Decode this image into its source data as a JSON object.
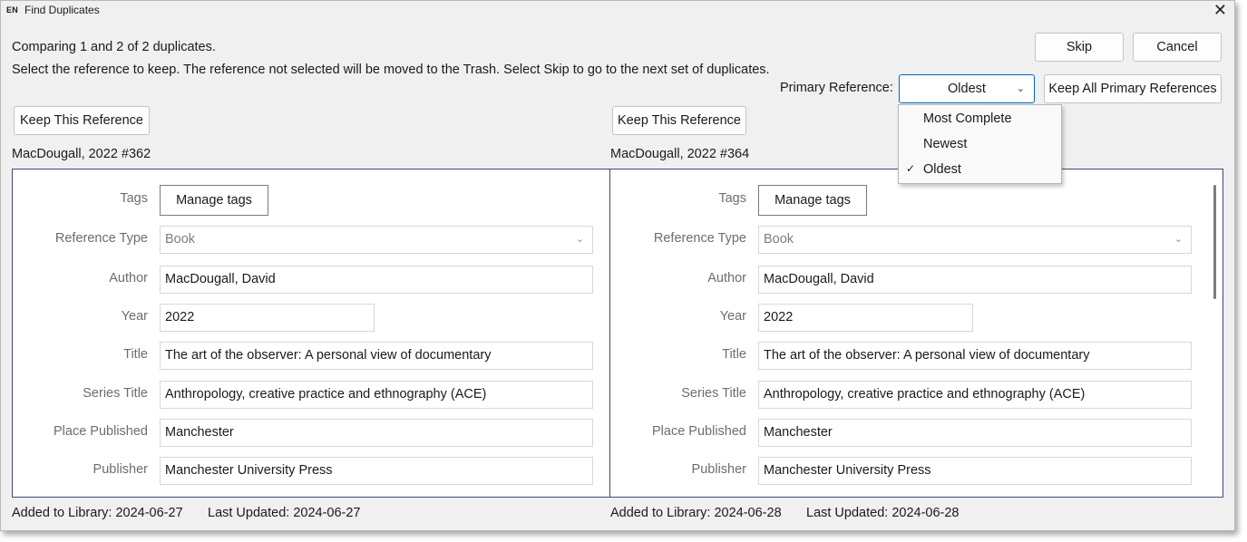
{
  "window": {
    "lang_badge": "EN",
    "title": "Find Duplicates",
    "close_glyph": "✕"
  },
  "header": {
    "comparing_text": "Comparing 1 and 2 of 2 duplicates.",
    "instructions_text": "Select the reference to keep. The reference not selected will be moved to the Trash. Select Skip to go to the next set of duplicates.",
    "skip_label": "Skip",
    "cancel_label": "Cancel",
    "primary_reference_label": "Primary Reference:",
    "primary_reference_value": "Oldest",
    "keep_all_label": "Keep All Primary References"
  },
  "primary_reference_options": [
    {
      "label": "Most Complete",
      "selected": false
    },
    {
      "label": "Newest",
      "selected": false
    },
    {
      "label": "Oldest",
      "selected": true,
      "check": "✓"
    }
  ],
  "icons": {
    "chevron": "chevron-down-icon",
    "check": "check-icon",
    "close": "close-icon"
  },
  "colors": {
    "accent": "#0067c0",
    "panel_border": "#3c4b78",
    "label_gray": "#6d6d6d"
  },
  "field_labels": {
    "tags": "Tags",
    "reference_type": "Reference Type",
    "author": "Author",
    "year": "Year",
    "title": "Title",
    "series_title": "Series Title",
    "place_published": "Place Published",
    "publisher": "Publisher"
  },
  "references": [
    {
      "keep_label": "Keep This Reference",
      "citation": "MacDougall, 2022 #362",
      "manage_tags_label": "Manage tags",
      "reference_type": "Book",
      "author": "MacDougall, David",
      "year": "2022",
      "title": "The art of the observer: A personal view of documentary",
      "series_title": "Anthropology, creative practice and ethnography (ACE)",
      "place_published": "Manchester",
      "publisher": "Manchester University Press",
      "added_to_library": "Added to Library: 2024-06-27",
      "last_updated": "Last Updated: 2024-06-27"
    },
    {
      "keep_label": "Keep This Reference",
      "citation": "MacDougall, 2022 #364",
      "manage_tags_label": "Manage tags",
      "reference_type": "Book",
      "author": "MacDougall, David",
      "year": "2022",
      "title": "The art of the observer: A personal view of documentary",
      "series_title": "Anthropology, creative practice and ethnography (ACE)",
      "place_published": "Manchester",
      "publisher": "Manchester University Press",
      "added_to_library": "Added to Library: 2024-06-28",
      "last_updated": "Last Updated: 2024-06-28"
    }
  ]
}
